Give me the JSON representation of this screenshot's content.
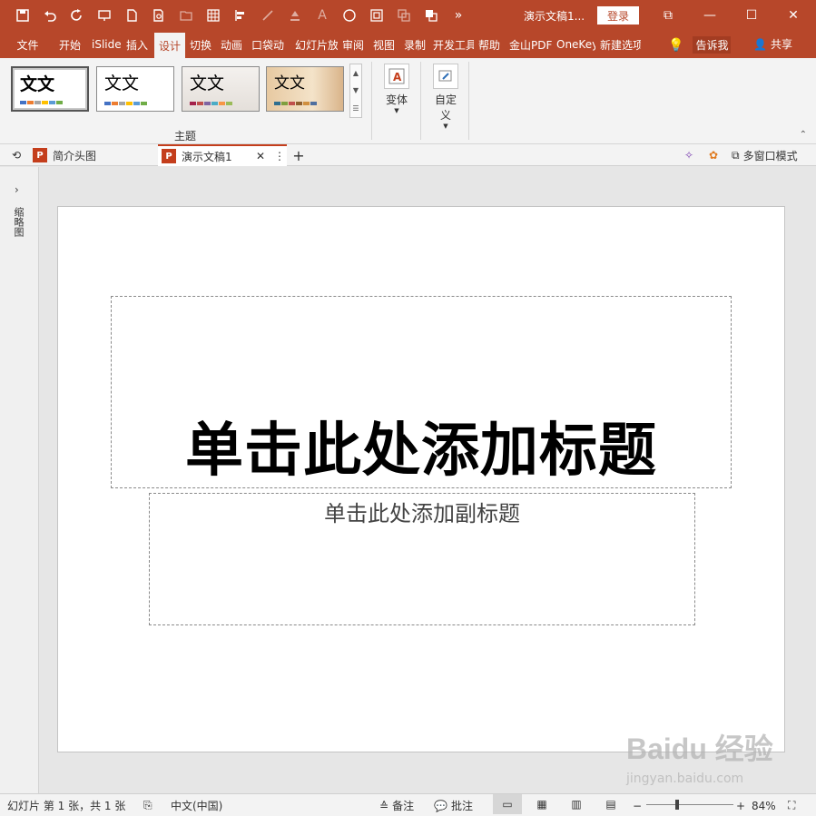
{
  "titlebar": {
    "qat": [
      "save-icon",
      "undo-icon",
      "redo-icon",
      "present-icon",
      "new-doc-icon",
      "print-preview-icon",
      "open-icon",
      "table-icon",
      "align-icon",
      "eyedropper-icon",
      "fill-icon",
      "font-color-icon",
      "circle-shape-icon",
      "select-icon",
      "group-icon",
      "arrange-icon",
      "more-icon"
    ],
    "doc_title": "演示文稿1...",
    "login": "登录",
    "controls": [
      "ribbon-display-icon",
      "minimize-icon",
      "maximize-icon",
      "close-icon"
    ]
  },
  "tabs": [
    "文件",
    "开始",
    "iSlide",
    "插入",
    "设计",
    "切换",
    "动画",
    "口袋动",
    "幻灯片放",
    "审阅",
    "视图",
    "录制",
    "开发工具",
    "帮助",
    "金山PDF",
    "OneKey",
    "新建选项"
  ],
  "active_tab": "设计",
  "tellme": "告诉我",
  "share": "共享",
  "ribbon": {
    "themes": [
      {
        "text": "文文",
        "colors": [
          "#4472c4",
          "#ed7d31",
          "#a5a5a5",
          "#ffc000",
          "#5b9bd5",
          "#70ad47"
        ]
      },
      {
        "text": "文文",
        "colors": [
          "#4472c4",
          "#ed7d31",
          "#a5a5a5",
          "#ffc000",
          "#5b9bd5",
          "#70ad47"
        ]
      },
      {
        "text": "文文",
        "colors": [
          "#a5224b",
          "#c0504d",
          "#8064a2",
          "#4bacc6",
          "#f79646",
          "#9bbb59"
        ]
      },
      {
        "text": "文文",
        "colors": [
          "#2f6f8f",
          "#7f9f3f",
          "#c0504d",
          "#8f5f2f",
          "#d08f3f",
          "#4f6f9f"
        ]
      }
    ],
    "group_themes": "主题",
    "variants": "变体",
    "customize": "自定义"
  },
  "doctabs": {
    "tab1": "简介头图",
    "tab2": "演示文稿1",
    "multiwindow": "多窗口模式"
  },
  "leftpane": {
    "label": "缩略图"
  },
  "slide": {
    "title_placeholder": "单击此处添加标题",
    "subtitle_placeholder": "单击此处添加副标题"
  },
  "watermark": {
    "line1": "Baidu 经验",
    "line2": "jingyan.baidu.com"
  },
  "statusbar": {
    "slide_info": "幻灯片 第 1 张，共 1 张",
    "language": "中文(中国)",
    "notes": "备注",
    "comments": "批注",
    "zoom": "84%",
    "zoom_fraction": 0.35
  }
}
